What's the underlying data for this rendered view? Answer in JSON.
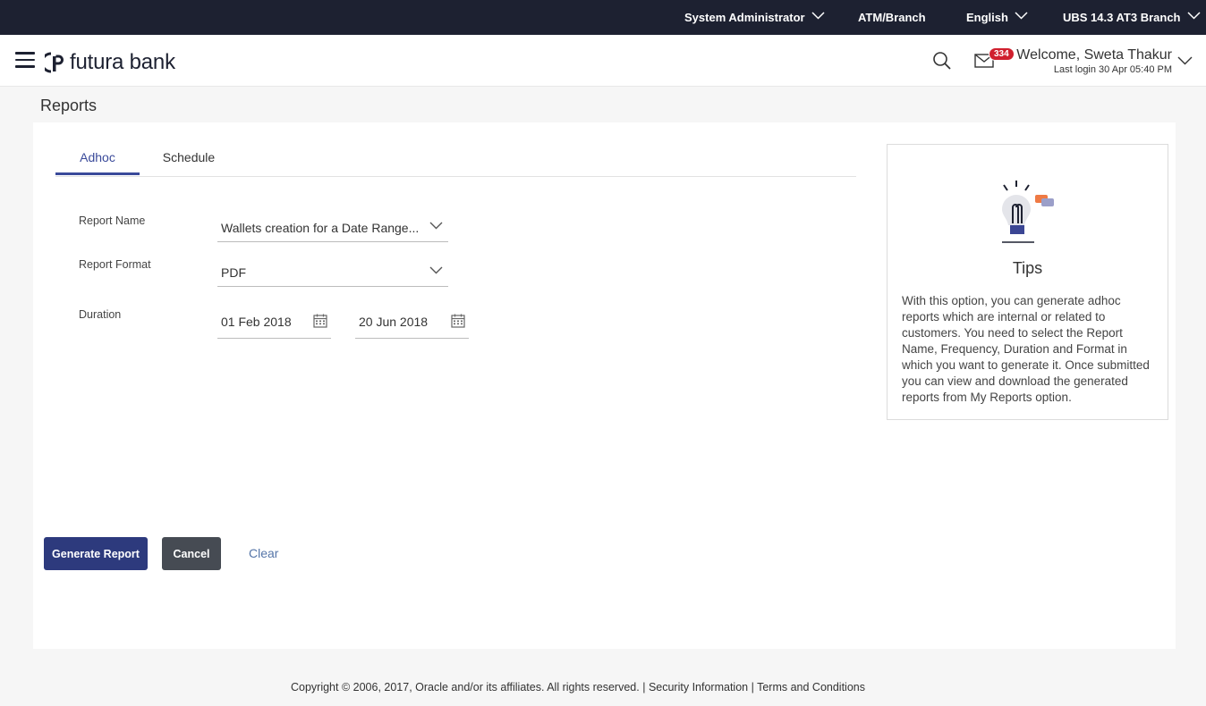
{
  "topbar": {
    "role": "System Administrator",
    "atm_branch": "ATM/Branch",
    "language": "English",
    "branch": "UBS 14.3 AT3 Branch"
  },
  "header": {
    "logo_text": "futura bank",
    "notification_count": "334",
    "welcome": "Welcome, Sweta Thakur",
    "last_login": "Last login 30 Apr 05:40 PM"
  },
  "page": {
    "title": "Reports",
    "tabs": [
      {
        "label": "Adhoc",
        "active": true
      },
      {
        "label": "Schedule",
        "active": false
      }
    ]
  },
  "form": {
    "report_name_label": "Report Name",
    "report_name_value": "Wallets creation for a Date Range...",
    "report_format_label": "Report Format",
    "report_format_value": "PDF",
    "duration_label": "Duration",
    "duration_from": "01 Feb 2018",
    "duration_to": "20 Jun 2018"
  },
  "tips": {
    "title": "Tips",
    "text": "With this option, you can generate adhoc reports which are internal or related to customers. You need to select the Report Name, Frequency, Duration and Format in which you want to generate it. Once submitted you can view and download the generated reports from My Reports option."
  },
  "actions": {
    "generate": "Generate Report",
    "cancel": "Cancel",
    "clear": "Clear"
  },
  "footer": {
    "copyright": "Copyright © 2006, 2017, Oracle and/or its affiliates. All rights reserved.",
    "separator": "|",
    "security": "Security Information",
    "terms": "Terms and Conditions"
  },
  "colors": {
    "topbar_bg": "#1d2131",
    "accent": "#2d3a7d",
    "badge": "#d0202e",
    "link": "#5575a8"
  }
}
